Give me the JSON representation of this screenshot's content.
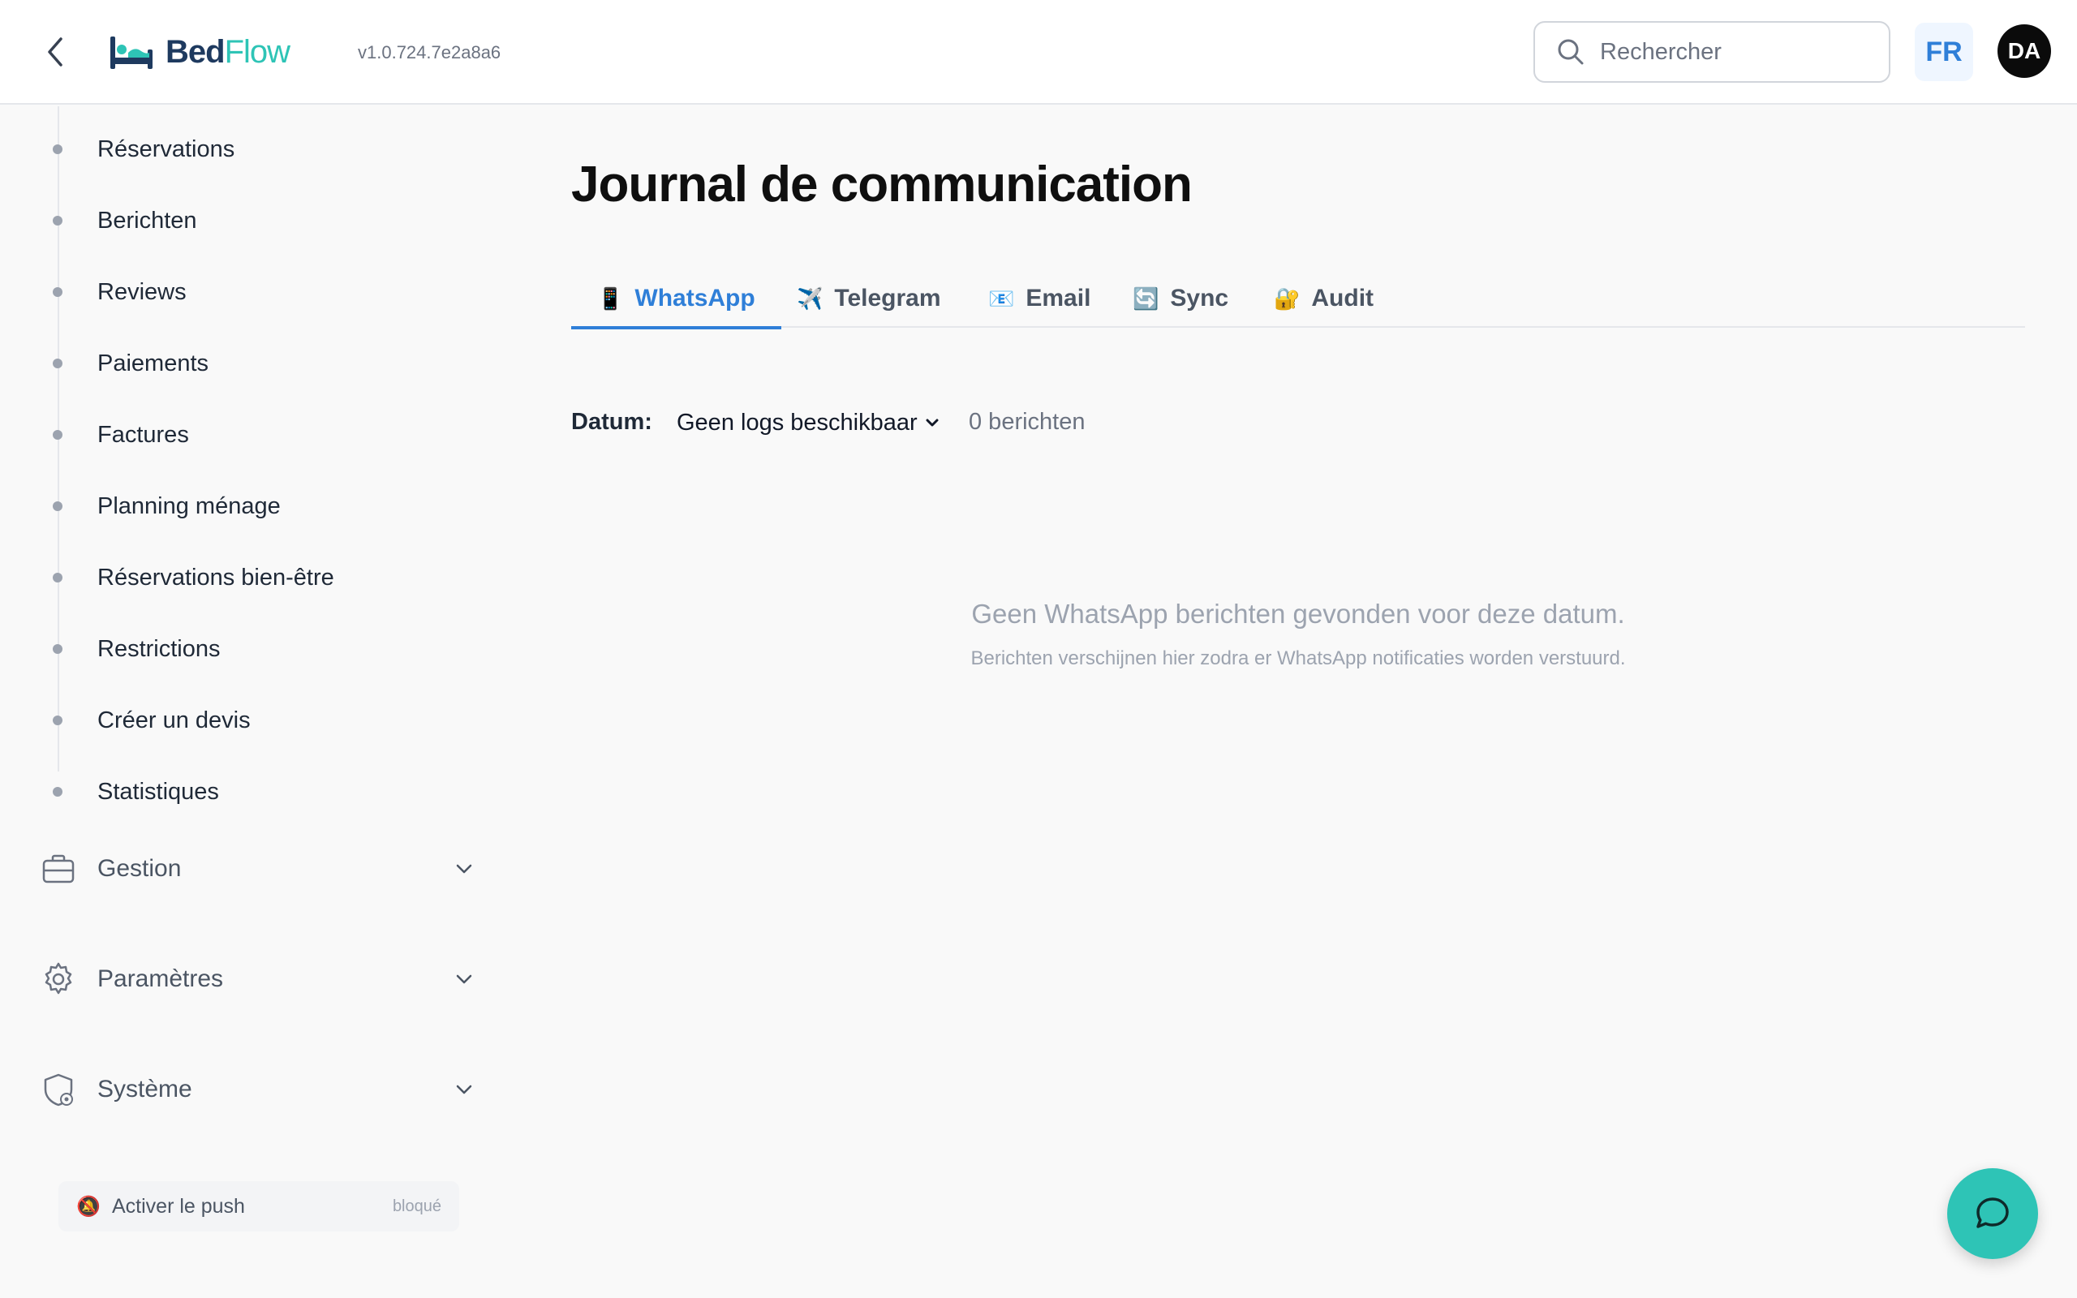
{
  "header": {
    "logo_part1": "Bed",
    "logo_part2": "Flow",
    "version": "v1.0.724.7e2a8a6",
    "search_placeholder": "Rechercher",
    "language": "FR",
    "avatar_initials": "DA"
  },
  "sidebar": {
    "items": [
      {
        "label": "Réservations"
      },
      {
        "label": "Berichten"
      },
      {
        "label": "Reviews"
      },
      {
        "label": "Paiements"
      },
      {
        "label": "Factures"
      },
      {
        "label": "Planning ménage"
      },
      {
        "label": "Réservations bien-être"
      },
      {
        "label": "Restrictions"
      },
      {
        "label": "Créer un devis"
      },
      {
        "label": "Statistiques"
      }
    ],
    "groups": [
      {
        "label": "Gestion",
        "icon": "briefcase-icon"
      },
      {
        "label": "Paramètres",
        "icon": "gear-icon"
      },
      {
        "label": "Système",
        "icon": "shield-gear-icon"
      }
    ],
    "push": {
      "label": "Activer le push",
      "status": "bloqué"
    }
  },
  "main": {
    "title": "Journal de communication",
    "tabs": [
      {
        "label": "WhatsApp",
        "icon": "📱",
        "active": true
      },
      {
        "label": "Telegram",
        "icon": "✈️",
        "active": false
      },
      {
        "label": "Email",
        "icon": "📧",
        "active": false
      },
      {
        "label": "Sync",
        "icon": "🔄",
        "active": false
      },
      {
        "label": "Audit",
        "icon": "🔐",
        "active": false
      }
    ],
    "filter": {
      "label": "Datum:",
      "selected": "Geen logs beschikbaar",
      "count": "0 berichten"
    },
    "empty": {
      "title": "Geen WhatsApp berichten gevonden voor deze datum.",
      "subtitle": "Berichten verschijnen hier zodra er WhatsApp notificaties worden verstuurd."
    }
  },
  "colors": {
    "accent": "#2f7fd8",
    "brand_teal": "#2ec4b6",
    "brand_navy": "#1e3a5f"
  }
}
